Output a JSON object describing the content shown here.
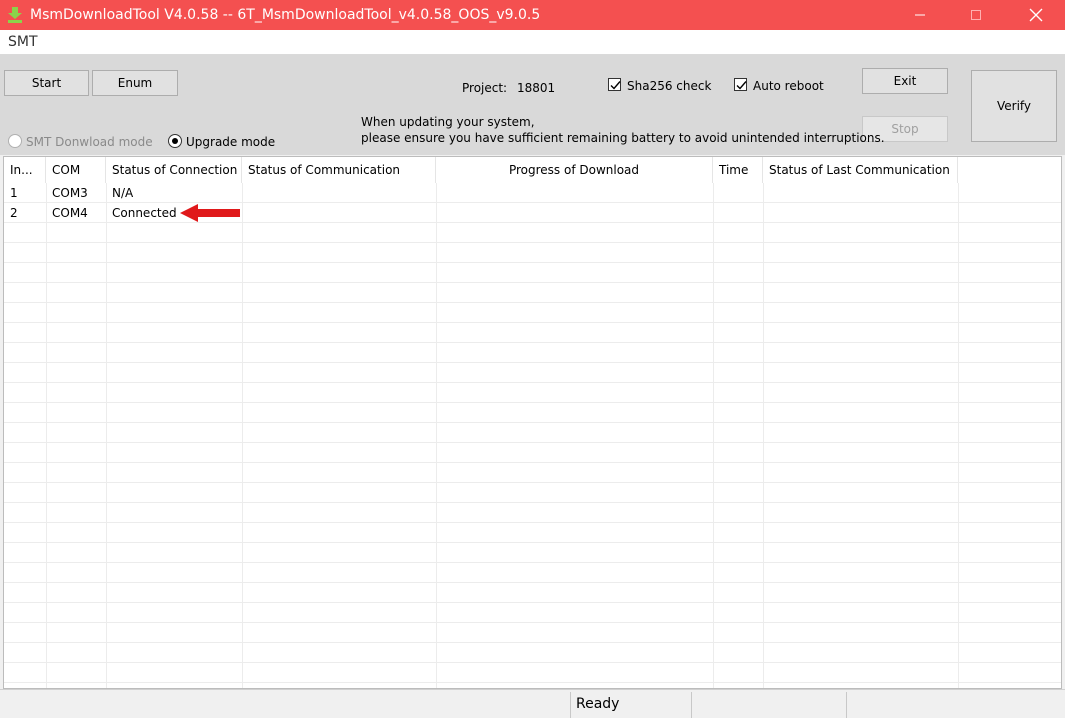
{
  "window": {
    "title": "MsmDownloadTool V4.0.58 -- 6T_MsmDownloadTool_v4.0.58_OOS_v9.0.5",
    "app_icon": "download-arrow-icon",
    "controls": [
      "minimize-icon",
      "maximize-icon",
      "close-icon"
    ],
    "title_bar_color": "#f45050"
  },
  "menu": {
    "items": [
      "SMT"
    ]
  },
  "toolbar": {
    "start_label": "Start",
    "enum_label": "Enum",
    "project_label": "Project:",
    "project_value": "18801",
    "sha256_label": "Sha256 check",
    "sha256_checked": true,
    "auto_reboot_label": "Auto reboot",
    "auto_reboot_checked": true,
    "exit_label": "Exit",
    "stop_label": "Stop",
    "verify_label": "Verify",
    "notice_line1": "When updating your system,",
    "notice_line2": "please ensure you have sufficient remaining battery to avoid unintended interruptions.",
    "smt_mode_label": "SMT Donwload mode",
    "upgrade_mode_label": "Upgrade mode",
    "selected_mode": "Upgrade mode"
  },
  "table": {
    "columns": [
      "In...",
      "COM",
      "Status of Connection",
      "Status of Communication",
      "Progress of Download",
      "Time",
      "Status of Last Communication"
    ],
    "rows": [
      {
        "index": "1",
        "com": "COM3",
        "connection": "N/A",
        "communication": "",
        "progress": "",
        "time": "",
        "last": ""
      },
      {
        "index": "2",
        "com": "COM4",
        "connection": "Connected",
        "communication": "",
        "progress": "",
        "time": "",
        "last": ""
      }
    ],
    "annotation_arrow_color": "#e0191b"
  },
  "status_bar": {
    "text": "Ready"
  }
}
